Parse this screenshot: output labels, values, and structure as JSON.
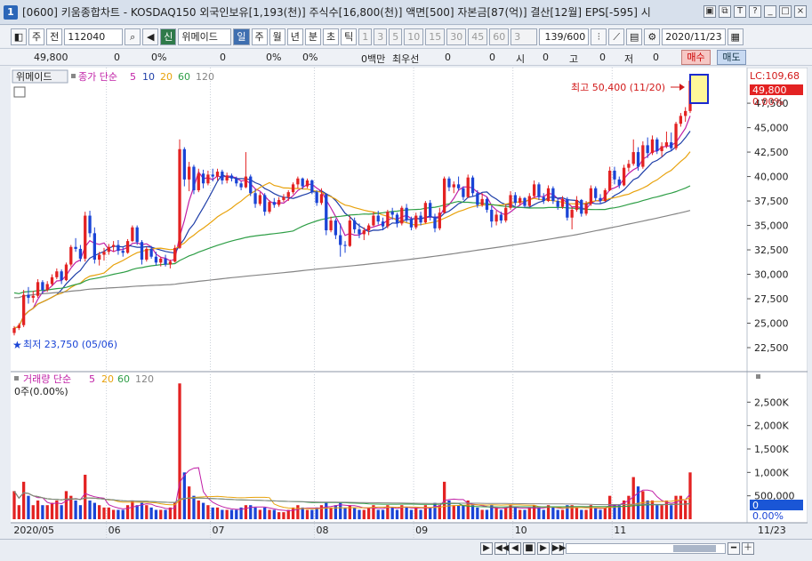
{
  "window": {
    "title": "[0600] 키움종합차트 - KOSDAQ150 외국인보유[1,193(천)] 주식수[16,800(천)] 액면[500] 자본금[87(억)] 결산[12월] EPS[-595] 시",
    "app_icon": "1",
    "controls": [
      "▣",
      "⧉",
      "T",
      "?",
      "_",
      "□",
      "×"
    ]
  },
  "toolbar": {
    "type_button": "주",
    "all_button": "전",
    "code_value": "112040",
    "new_badge": "신",
    "stock_name": "위메이드",
    "period_buttons": [
      "일",
      "주",
      "월",
      "년",
      "분",
      "초",
      "틱"
    ],
    "active_period": "일",
    "interval_buttons": [
      "1",
      "3",
      "5",
      "10",
      "15",
      "30",
      "45",
      "60"
    ],
    "interval_value": "3",
    "count_value": "139/600",
    "date_value": "2020/11/23"
  },
  "infobar": {
    "price": "49,800",
    "change": "0",
    "change_pct": "0%",
    "volume": "0",
    "volume_pct": "0%",
    "vol_change": "0%",
    "amount": "0백만",
    "best_bid_label": "최우선",
    "best_bid": "0",
    "v2": "0",
    "open_label": "시",
    "open": "0",
    "high_label": "고",
    "high": "0",
    "low_label": "저",
    "low": "0",
    "buy_label": "매수",
    "sell_label": "매도"
  },
  "price_panel": {
    "stock_tag": "위메이드",
    "legend_label": "종가 단순",
    "ma_periods": [
      "5",
      "10",
      "20",
      "60",
      "120"
    ],
    "high_annotation": "최고 50,400 (11/20)",
    "low_annotation": "최저 23,750 (05/06)",
    "lc_label": "LC:109,68",
    "current_price_label": "49,800",
    "pct_label": "0.00%"
  },
  "volume_panel": {
    "legend_label": "거래량 단순",
    "ma_periods": [
      "5",
      "20",
      "60",
      "120"
    ],
    "current_label": "0주(0.00%)",
    "current_value_label": "0",
    "current_pct_label": "0.00%"
  },
  "x_axis_labels": [
    "2020/05",
    "06",
    "07",
    "08",
    "09",
    "10",
    "11",
    "11/23"
  ],
  "bottom_controls": [
    "▶",
    "◀◀",
    "◀",
    "■",
    "▶",
    "▶▶",
    "━",
    "＋"
  ],
  "colors": {
    "up": "#e32222",
    "down": "#1a44d6",
    "ma5": "#c01fa6",
    "ma10": "#1e3ea8",
    "ma20": "#e8a20c",
    "ma60": "#2e9e46",
    "ma120": "#858585",
    "highlight": "#fff799",
    "price_flag": "#e32222"
  },
  "chart_data": {
    "type": "candlestick",
    "price_axis": {
      "min": 21500,
      "max": 50600,
      "ticks": [
        22500,
        25000,
        27500,
        30000,
        32500,
        35000,
        37500,
        40000,
        42500,
        45000,
        47500
      ]
    },
    "volume_axis": {
      "min": 0,
      "max": 3000000,
      "ticks": [
        500000,
        1000000,
        1500000,
        2000000,
        2500000
      ],
      "tick_labels": [
        "500,000",
        "1,000K",
        "1,500K",
        "2,000K",
        "2,500K"
      ]
    },
    "month_starts": [
      0,
      20,
      42,
      64,
      85,
      106,
      127
    ],
    "x_labels": [
      "2020/05",
      "06",
      "07",
      "08",
      "09",
      "10",
      "11"
    ],
    "candles": [
      [
        24000,
        24700,
        23750,
        24500,
        600000
      ],
      [
        24500,
        25000,
        24300,
        24800,
        300000
      ],
      [
        24800,
        28400,
        24600,
        27900,
        800000
      ],
      [
        27900,
        28700,
        27000,
        27600,
        500000
      ],
      [
        27600,
        28300,
        27100,
        27800,
        300000
      ],
      [
        27800,
        29500,
        27600,
        29200,
        400000
      ],
      [
        29200,
        29400,
        28000,
        28400,
        300000
      ],
      [
        28400,
        29300,
        28200,
        29000,
        300000
      ],
      [
        29000,
        30000,
        28800,
        29700,
        350000
      ],
      [
        29700,
        30600,
        29500,
        30300,
        400000
      ],
      [
        30300,
        30500,
        29000,
        29400,
        300000
      ],
      [
        29400,
        31200,
        29300,
        31000,
        600000
      ],
      [
        31000,
        33000,
        30800,
        32800,
        500000
      ],
      [
        32800,
        33700,
        32300,
        32600,
        400000
      ],
      [
        32600,
        33000,
        31300,
        31600,
        300000
      ],
      [
        31600,
        36400,
        31300,
        36000,
        950000
      ],
      [
        36000,
        36500,
        33800,
        34200,
        400000
      ],
      [
        34200,
        34800,
        31100,
        31500,
        350000
      ],
      [
        31500,
        32300,
        30900,
        32000,
        300000
      ],
      [
        32000,
        32700,
        31400,
        32300,
        250000
      ],
      [
        32300,
        33100,
        32000,
        32800,
        250000
      ],
      [
        32800,
        33400,
        32300,
        33000,
        200000
      ],
      [
        33000,
        33500,
        32000,
        32400,
        200000
      ],
      [
        32400,
        32800,
        31800,
        32200,
        200000
      ],
      [
        32200,
        33600,
        32100,
        33400,
        300000
      ],
      [
        33400,
        35000,
        33300,
        34800,
        400000
      ],
      [
        34800,
        35000,
        33000,
        33300,
        300000
      ],
      [
        33300,
        33500,
        31000,
        31500,
        350000
      ],
      [
        31500,
        32800,
        31300,
        32600,
        300000
      ],
      [
        32600,
        32900,
        31600,
        31800,
        250000
      ],
      [
        31800,
        32300,
        30900,
        31200,
        200000
      ],
      [
        31200,
        31800,
        30800,
        31600,
        200000
      ],
      [
        31600,
        32000,
        30800,
        31000,
        200000
      ],
      [
        31000,
        31500,
        30600,
        31300,
        250000
      ],
      [
        31300,
        33000,
        31200,
        32700,
        350000
      ],
      [
        32700,
        43800,
        32600,
        42800,
        2900000
      ],
      [
        42800,
        43000,
        39000,
        39700,
        1000000
      ],
      [
        39700,
        41500,
        38500,
        41000,
        700000
      ],
      [
        41000,
        41200,
        38200,
        38600,
        500000
      ],
      [
        38600,
        40800,
        38400,
        40300,
        400000
      ],
      [
        40300,
        40700,
        38800,
        39300,
        350000
      ],
      [
        39300,
        40600,
        39100,
        40200,
        300000
      ],
      [
        40200,
        40800,
        39500,
        40000,
        250000
      ],
      [
        40000,
        40800,
        39600,
        40500,
        250000
      ],
      [
        40500,
        40700,
        39200,
        39600,
        200000
      ],
      [
        39600,
        40400,
        39300,
        40100,
        200000
      ],
      [
        40100,
        40300,
        39500,
        39800,
        200000
      ],
      [
        39800,
        40000,
        39000,
        39300,
        200000
      ],
      [
        39300,
        39500,
        38600,
        38900,
        250000
      ],
      [
        38900,
        42500,
        38800,
        40000,
        300000
      ],
      [
        40000,
        40200,
        38000,
        38300,
        300000
      ],
      [
        38300,
        38700,
        36800,
        37200,
        250000
      ],
      [
        37200,
        38400,
        37000,
        38100,
        200000
      ],
      [
        38100,
        38300,
        36000,
        36400,
        250000
      ],
      [
        36400,
        37600,
        36200,
        37400,
        200000
      ],
      [
        37400,
        37800,
        36800,
        37100,
        200000
      ],
      [
        37100,
        37900,
        36900,
        37600,
        150000
      ],
      [
        37600,
        38200,
        37400,
        37900,
        150000
      ],
      [
        37900,
        38600,
        37500,
        38400,
        200000
      ],
      [
        38400,
        39400,
        38200,
        39200,
        250000
      ],
      [
        39200,
        40000,
        38800,
        39800,
        300000
      ],
      [
        39800,
        39900,
        38700,
        39000,
        250000
      ],
      [
        39000,
        39800,
        38800,
        39600,
        200000
      ],
      [
        39600,
        39700,
        38200,
        38400,
        200000
      ],
      [
        38400,
        38600,
        37000,
        37300,
        250000
      ],
      [
        37300,
        38800,
        37100,
        38200,
        300000
      ],
      [
        38200,
        38300,
        34000,
        34500,
        350000
      ],
      [
        34500,
        35900,
        34300,
        35500,
        250000
      ],
      [
        35500,
        35700,
        33600,
        34000,
        300000
      ],
      [
        34000,
        35200,
        31800,
        33000,
        350000
      ],
      [
        33000,
        33400,
        32200,
        32900,
        250000
      ],
      [
        32900,
        36000,
        32800,
        35500,
        300000
      ],
      [
        35500,
        35800,
        34200,
        34600,
        250000
      ],
      [
        34600,
        35200,
        33700,
        34100,
        200000
      ],
      [
        34100,
        34800,
        33500,
        34500,
        200000
      ],
      [
        34500,
        35200,
        34000,
        35000,
        250000
      ],
      [
        35000,
        36400,
        34900,
        36000,
        300000
      ],
      [
        36000,
        36500,
        35100,
        35400,
        200000
      ],
      [
        35400,
        35800,
        34500,
        34900,
        200000
      ],
      [
        34900,
        36600,
        34700,
        36400,
        300000
      ],
      [
        36400,
        36800,
        35600,
        36100,
        250000
      ],
      [
        36100,
        36300,
        34800,
        35200,
        200000
      ],
      [
        35200,
        37000,
        35000,
        36800,
        300000
      ],
      [
        36800,
        37200,
        35300,
        35600,
        250000
      ],
      [
        35600,
        35900,
        34500,
        34800,
        200000
      ],
      [
        34800,
        36300,
        34600,
        36000,
        250000
      ],
      [
        36000,
        36400,
        35000,
        35300,
        200000
      ],
      [
        35300,
        37500,
        35200,
        37300,
        300000
      ],
      [
        37300,
        37600,
        35500,
        35900,
        250000
      ],
      [
        35900,
        36200,
        34300,
        34700,
        350000
      ],
      [
        34700,
        36800,
        34500,
        36300,
        300000
      ],
      [
        36300,
        40000,
        36200,
        39800,
        800000
      ],
      [
        39800,
        40000,
        38500,
        38900,
        400000
      ],
      [
        38900,
        39500,
        38300,
        39200,
        300000
      ],
      [
        39200,
        40000,
        38600,
        38800,
        300000
      ],
      [
        38800,
        39000,
        37600,
        37900,
        300000
      ],
      [
        37900,
        40200,
        37800,
        39900,
        400000
      ],
      [
        39900,
        40100,
        38000,
        38300,
        300000
      ],
      [
        38300,
        38600,
        36800,
        37100,
        250000
      ],
      [
        37100,
        38300,
        36900,
        37700,
        200000
      ],
      [
        37700,
        37900,
        36300,
        36600,
        200000
      ],
      [
        36600,
        37000,
        34800,
        35400,
        300000
      ],
      [
        35400,
        36500,
        35000,
        36100,
        250000
      ],
      [
        36100,
        36400,
        35200,
        35500,
        200000
      ],
      [
        35500,
        37100,
        35300,
        36800,
        250000
      ],
      [
        36800,
        38500,
        36600,
        38100,
        300000
      ],
      [
        38100,
        38400,
        37000,
        37300,
        250000
      ],
      [
        37300,
        38000,
        37000,
        37800,
        200000
      ],
      [
        37800,
        37900,
        36800,
        37000,
        200000
      ],
      [
        37000,
        38300,
        36900,
        38000,
        250000
      ],
      [
        38000,
        39600,
        37800,
        39200,
        300000
      ],
      [
        39200,
        39400,
        37600,
        37900,
        250000
      ],
      [
        37900,
        38300,
        37200,
        37500,
        200000
      ],
      [
        37500,
        39100,
        37400,
        38800,
        300000
      ],
      [
        38800,
        39000,
        37200,
        37500,
        250000
      ],
      [
        37500,
        37800,
        36600,
        36900,
        200000
      ],
      [
        36900,
        38000,
        36700,
        37700,
        200000
      ],
      [
        37700,
        37900,
        35500,
        35800,
        300000
      ],
      [
        35800,
        36900,
        34600,
        36600,
        300000
      ],
      [
        36600,
        38000,
        36400,
        37600,
        250000
      ],
      [
        37600,
        37700,
        35900,
        36200,
        200000
      ],
      [
        36200,
        37500,
        36000,
        37200,
        200000
      ],
      [
        37200,
        39100,
        37000,
        38800,
        300000
      ],
      [
        38800,
        39000,
        37500,
        37800,
        250000
      ],
      [
        37800,
        38200,
        37200,
        37500,
        200000
      ],
      [
        37500,
        38800,
        37400,
        38600,
        250000
      ],
      [
        38600,
        41000,
        38500,
        40600,
        500000
      ],
      [
        40600,
        41000,
        39200,
        39700,
        300000
      ],
      [
        39700,
        40000,
        38800,
        39100,
        300000
      ],
      [
        39100,
        41200,
        39000,
        40900,
        400000
      ],
      [
        40900,
        41700,
        40500,
        41300,
        500000
      ],
      [
        41300,
        43800,
        41100,
        42500,
        900000
      ],
      [
        42500,
        43000,
        40600,
        41000,
        700000
      ],
      [
        41000,
        43600,
        40800,
        43200,
        600000
      ],
      [
        43200,
        44000,
        41900,
        42400,
        400000
      ],
      [
        42400,
        44200,
        42200,
        43800,
        400000
      ],
      [
        43800,
        44000,
        42300,
        42600,
        300000
      ],
      [
        42600,
        43500,
        42000,
        43100,
        300000
      ],
      [
        43100,
        44600,
        42900,
        43500,
        400000
      ],
      [
        43500,
        44500,
        42600,
        42900,
        300000
      ],
      [
        42900,
        45600,
        42700,
        45400,
        500000
      ],
      [
        45400,
        46500,
        45100,
        46200,
        500000
      ],
      [
        46200,
        47100,
        45600,
        46700,
        400000
      ],
      [
        46700,
        50400,
        46500,
        49800,
        1000000
      ]
    ],
    "ma": {
      "5": "derived",
      "10": "derived",
      "20": "derived",
      "60": "derived",
      "120": "derived"
    }
  }
}
